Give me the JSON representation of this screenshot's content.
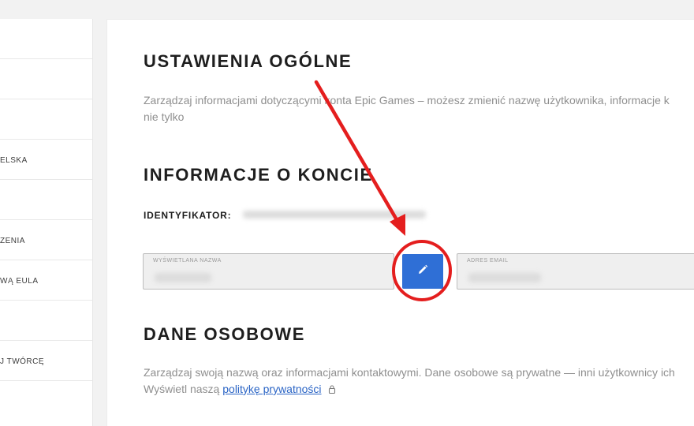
{
  "sidebar": {
    "items": [
      {
        "label": ""
      },
      {
        "label": ""
      },
      {
        "label": ""
      },
      {
        "label": "ELSKA"
      },
      {
        "label": ""
      },
      {
        "label": "ZENIA"
      },
      {
        "label": "WĄ EULA"
      },
      {
        "label": ""
      },
      {
        "label": "J TWÓRCĘ"
      }
    ]
  },
  "general": {
    "title": "USTAWIENIA OGÓLNE",
    "desc_line1": "Zarządzaj informacjami dotyczącymi konta Epic Games – możesz zmienić nazwę użytkownika, informacje k",
    "desc_line2": "nie tylko"
  },
  "account": {
    "title": "INFORMACJE O KONCIE",
    "id_label": "IDENTYFIKATOR:",
    "display_name_label": "WYŚWIETLANA NAZWA",
    "email_label": "ADRES EMAIL"
  },
  "personal": {
    "title": "DANE OSOBOWE",
    "desc_line1": "Zarządzaj swoją nazwą oraz informacjami kontaktowymi. Dane osobowe są prywatne — inni użytkownicy ich",
    "desc_prefix": "Wyświetl naszą ",
    "privacy_link": "politykę prywatności"
  },
  "colors": {
    "accent": "#2f6fd6",
    "annotation": "#e41e1e"
  }
}
